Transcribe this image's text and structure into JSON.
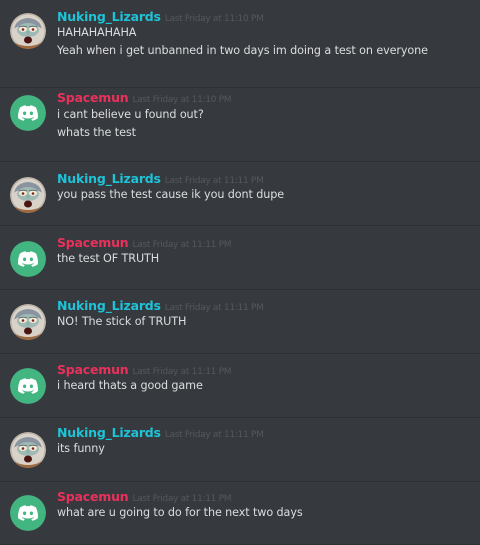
{
  "colors": {
    "background": "#36393e",
    "nuking_name": "#1ec3d8",
    "spacemun_name": "#e9315b",
    "discord_avatar_bg": "#43b581",
    "timestamp": "#55585e",
    "message_text": "#dcddde"
  },
  "messages": [
    {
      "author": "Nuking_Lizards",
      "avatar": "squidward-avatar",
      "timestamp": "Last Friday at 11:10 PM",
      "lines": [
        "HAHAHAHAHA",
        "Yeah when i get unbanned in two days im doing a test on everyone"
      ]
    },
    {
      "author": "Spacemun",
      "avatar": "discord-logo-avatar",
      "timestamp": "Last Friday at 11:10 PM",
      "lines": [
        "i cant believe u found out?",
        "whats the test"
      ]
    },
    {
      "author": "Nuking_Lizards",
      "avatar": "squidward-avatar",
      "timestamp": "Last Friday at 11:11 PM",
      "lines": [
        "you pass the test cause ik you dont dupe"
      ]
    },
    {
      "author": "Spacemun",
      "avatar": "discord-logo-avatar",
      "timestamp": "Last Friday at 11:11 PM",
      "lines": [
        "the test OF TRUTH"
      ]
    },
    {
      "author": "Nuking_Lizards",
      "avatar": "squidward-avatar",
      "timestamp": "Last Friday at 11:11 PM",
      "lines": [
        "NO! The stick of TRUTH"
      ]
    },
    {
      "author": "Spacemun",
      "avatar": "discord-logo-avatar",
      "timestamp": "Last Friday at 11:11 PM",
      "lines": [
        "i heard thats a good game"
      ]
    },
    {
      "author": "Nuking_Lizards",
      "avatar": "squidward-avatar",
      "timestamp": "Last Friday at 11:11 PM",
      "lines": [
        "its funny"
      ]
    },
    {
      "author": "Spacemun",
      "avatar": "discord-logo-avatar",
      "timestamp": "Last Friday at 11:11 PM",
      "lines": [
        "what are u going to do for the next two days"
      ]
    }
  ]
}
